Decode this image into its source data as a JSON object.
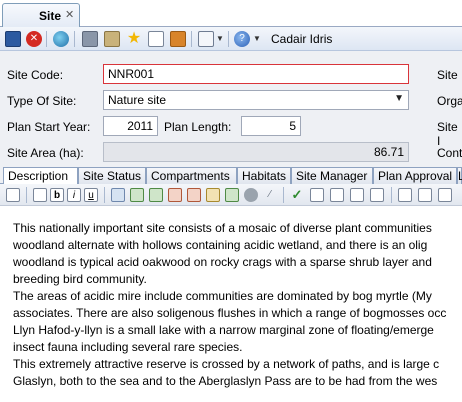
{
  "tab": {
    "label": "Site",
    "close": "✕"
  },
  "toolbar": {
    "title": "Cadair Idris",
    "icons": [
      "save-icon",
      "delete-icon",
      "globe-icon",
      "print-icon",
      "report-icon",
      "star-icon",
      "copy-icon",
      "tag-icon",
      "document-icon",
      "help-icon"
    ]
  },
  "form": {
    "site_code_label": "Site Code:",
    "site_code_value": "NNR001",
    "type_label": "Type Of Site:",
    "type_value": "Nature site",
    "start_year_label": "Plan Start Year:",
    "start_year_value": "2011",
    "plan_length_label": "Plan Length:",
    "plan_length_value": "5",
    "site_area_label": "Site Area (ha):",
    "site_area_value": "86.71",
    "right_cut_labels": [
      "Site",
      "Orga",
      "Site I",
      "Cont"
    ]
  },
  "subtabs": [
    "Description",
    "Site Status",
    "Compartments",
    "Habitats",
    "Site Manager",
    "Plan Approval",
    "L"
  ],
  "content_lines": [
    "This nationally important site consists of a mosaic of diverse plant communities",
    "woodland alternate with hollows containing acidic wetland, and there is an olig",
    "woodland is typical acid oakwood on rocky crags with a sparse shrub layer and",
    "breeding bird community.",
    "The areas of acidic mire include communities are dominated by bog myrtle (My",
    "associates. There are also soligenous flushes in which a range of bogmosses occ",
    "Llyn Hafod-y-llyn is a small lake with a narrow marginal zone of floating/emerge",
    "insect fauna including several rare species.",
    "This extremely attractive reserve is crossed by a network of paths, and is large c",
    "Glaslyn, both to the sea and to the Aberglaslyn Pass are to be had from the wes"
  ],
  "colors": {
    "accent": "#d9343a",
    "tab_border": "#7f9db9"
  }
}
